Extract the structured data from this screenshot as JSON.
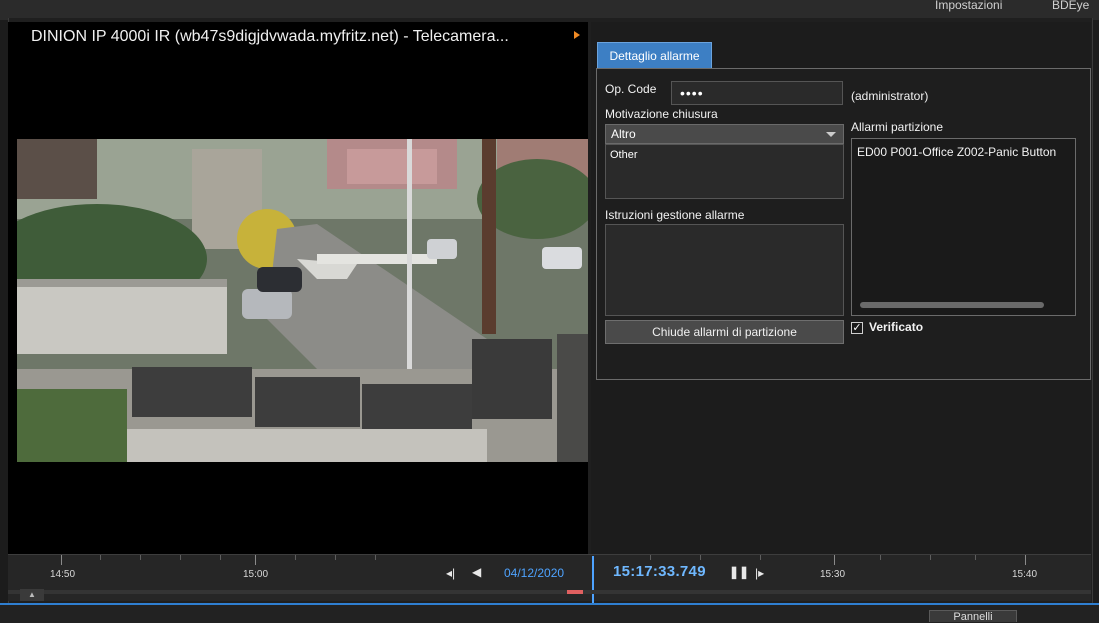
{
  "topbar": {
    "settings_label": "Impostazioni",
    "user_label": "BDEye"
  },
  "camera": {
    "title": "DINION IP 4000i IR (wb47s9digjdvwada.myfritz.net) - Telecamera..."
  },
  "alarm_panel": {
    "tab_label": "Dettaglio allarme",
    "opcode_label": "Op. Code",
    "opcode_value": "••••",
    "opcode_user": "(administrator)",
    "reason_label": "Motivazione chiusura",
    "reason_selected": "Altro",
    "reason_text": "Other",
    "instructions_label": "Istruzioni gestione allarme",
    "partition_label": "Allarmi partizione",
    "partition_items": [
      "ED00 P001-Office Z002-Panic Button"
    ],
    "close_button_label": "Chiude allarmi di partizione",
    "verified_label": "Verificato",
    "verified_checked": true
  },
  "timeline": {
    "labels": [
      "14:50",
      "15:00",
      "15:30",
      "15:40"
    ],
    "date": "04/12/2020",
    "time": "15:17:33.749"
  },
  "bottom": {
    "button_label": "Pannelli"
  },
  "colors": {
    "accent": "#3d7fc4",
    "time_text": "#6fb8ff",
    "marker": "#e06060",
    "play_arrow": "#f08a24"
  },
  "icons": [
    "skip-back-icon",
    "rewind-icon",
    "pause-icon",
    "skip-forward-icon",
    "dropdown-caret-icon",
    "checkbox-icon",
    "collapse-icon"
  ]
}
